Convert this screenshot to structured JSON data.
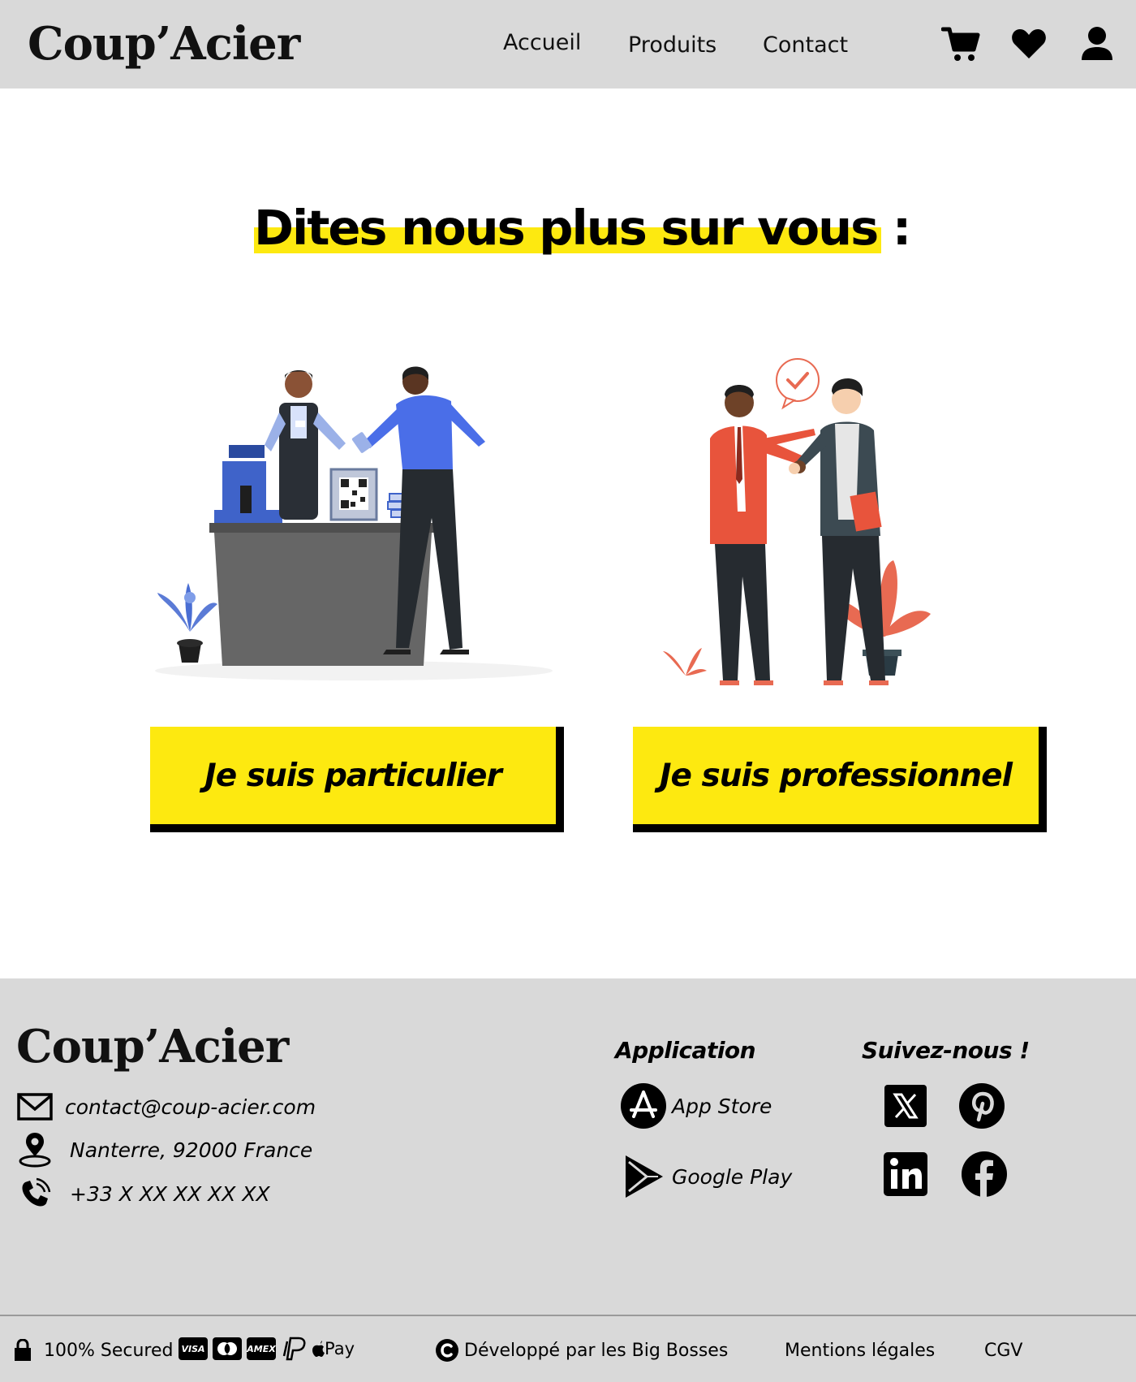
{
  "header": {
    "logo": "Coup’Acier",
    "nav": [
      {
        "label": "Accueil"
      },
      {
        "label": "Produits"
      },
      {
        "label": "Contact"
      }
    ],
    "icons": [
      "cart-icon",
      "heart-icon",
      "user-icon"
    ]
  },
  "main": {
    "heading": "Dites nous plus sur vous :",
    "choices": [
      {
        "label": "Je suis particulier",
        "illustration": "shop-checkout-illustration"
      },
      {
        "label": "Je suis professionnel",
        "illustration": "business-handshake-illustration"
      }
    ]
  },
  "footer": {
    "logo": "Coup’Acier",
    "contact": {
      "email": "contact@coup-acier.com",
      "address": "Nanterre, 92000 France",
      "phone": "+33 X XX XX XX XX"
    },
    "application": {
      "title": "Application",
      "stores": [
        {
          "label": "App Store",
          "icon": "app-store-icon"
        },
        {
          "label": "Google Play",
          "icon": "google-play-icon"
        }
      ]
    },
    "social": {
      "title": "Suivez-nous !",
      "networks": [
        "x-icon",
        "pinterest-icon",
        "linkedin-icon",
        "facebook-icon"
      ]
    }
  },
  "bottom_bar": {
    "secured": "100% Secured",
    "payment_methods": [
      "VISA",
      "Mastercard",
      "AMEX",
      "PayPal",
      "Pay"
    ],
    "developed_by": "Développé par les Big Bosses",
    "legal": "Mentions légales",
    "cgv": "CGV"
  },
  "colors": {
    "accent_yellow": "#fde910",
    "gray_bg": "#d9d9d9",
    "text": "#000000"
  }
}
